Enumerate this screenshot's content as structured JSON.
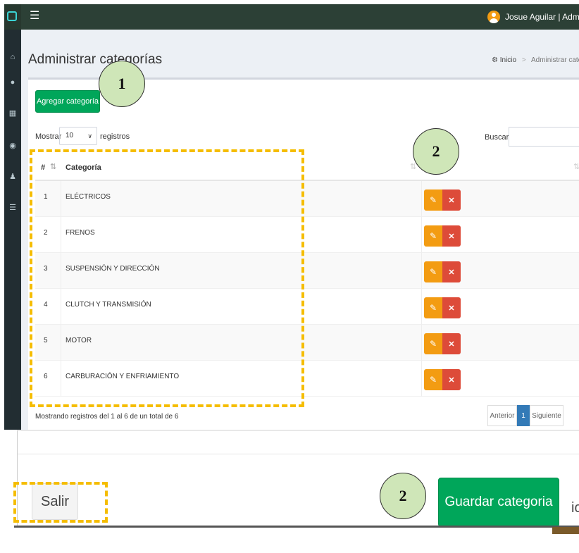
{
  "header": {
    "menu_icon": "menu-icon",
    "user_text": "Josue Aguilar | Administrado"
  },
  "sidebar": {
    "icons": [
      "home-icon",
      "user-icon",
      "grid-icon",
      "product-icon",
      "users-icon",
      "list-icon"
    ]
  },
  "page": {
    "title": "Administrar categorías",
    "breadcrumb_home": "Inicio",
    "breadcrumb_current": "Administrar categori"
  },
  "toolbar": {
    "add_label": "Agregar categoría"
  },
  "table_controls": {
    "show_label": "Mostrar",
    "length_value": "10",
    "length_suffix": "registros",
    "search_label": "Buscar:"
  },
  "table": {
    "headers": [
      "#",
      "Categoría"
    ],
    "rows": [
      {
        "num": "1",
        "name": "ELÉCTRICOS"
      },
      {
        "num": "2",
        "name": "FRENOS"
      },
      {
        "num": "3",
        "name": "SUSPENSIÓN Y DIRECCIÓN"
      },
      {
        "num": "4",
        "name": "CLUTCH Y TRANSMISIÓN"
      },
      {
        "num": "5",
        "name": "MOTOR"
      },
      {
        "num": "6",
        "name": "CARBURACIÓN Y ENFRIAMIENTO"
      }
    ],
    "info": "Mostrando registros del 1 al 6 de un total de 6"
  },
  "pagination": {
    "prev": "Anterior",
    "current": "1",
    "next": "Siguiente"
  },
  "dialog": {
    "exit_label": "Salir",
    "save_label": "Guardar categoria",
    "cut_text": "ic"
  },
  "annotations": {
    "callout_1": "1",
    "callout_2a": "2",
    "callout_2b": "2",
    "highlight_color": "#f5bd00",
    "callout_color": "#cfe6b8"
  },
  "colors": {
    "topbar": "#2c4036",
    "sidebar": "#222d32",
    "primary_green": "#00a65a",
    "edit_orange": "#f39c12",
    "delete_red": "#dd4b39",
    "page_blue": "#337ab7"
  }
}
